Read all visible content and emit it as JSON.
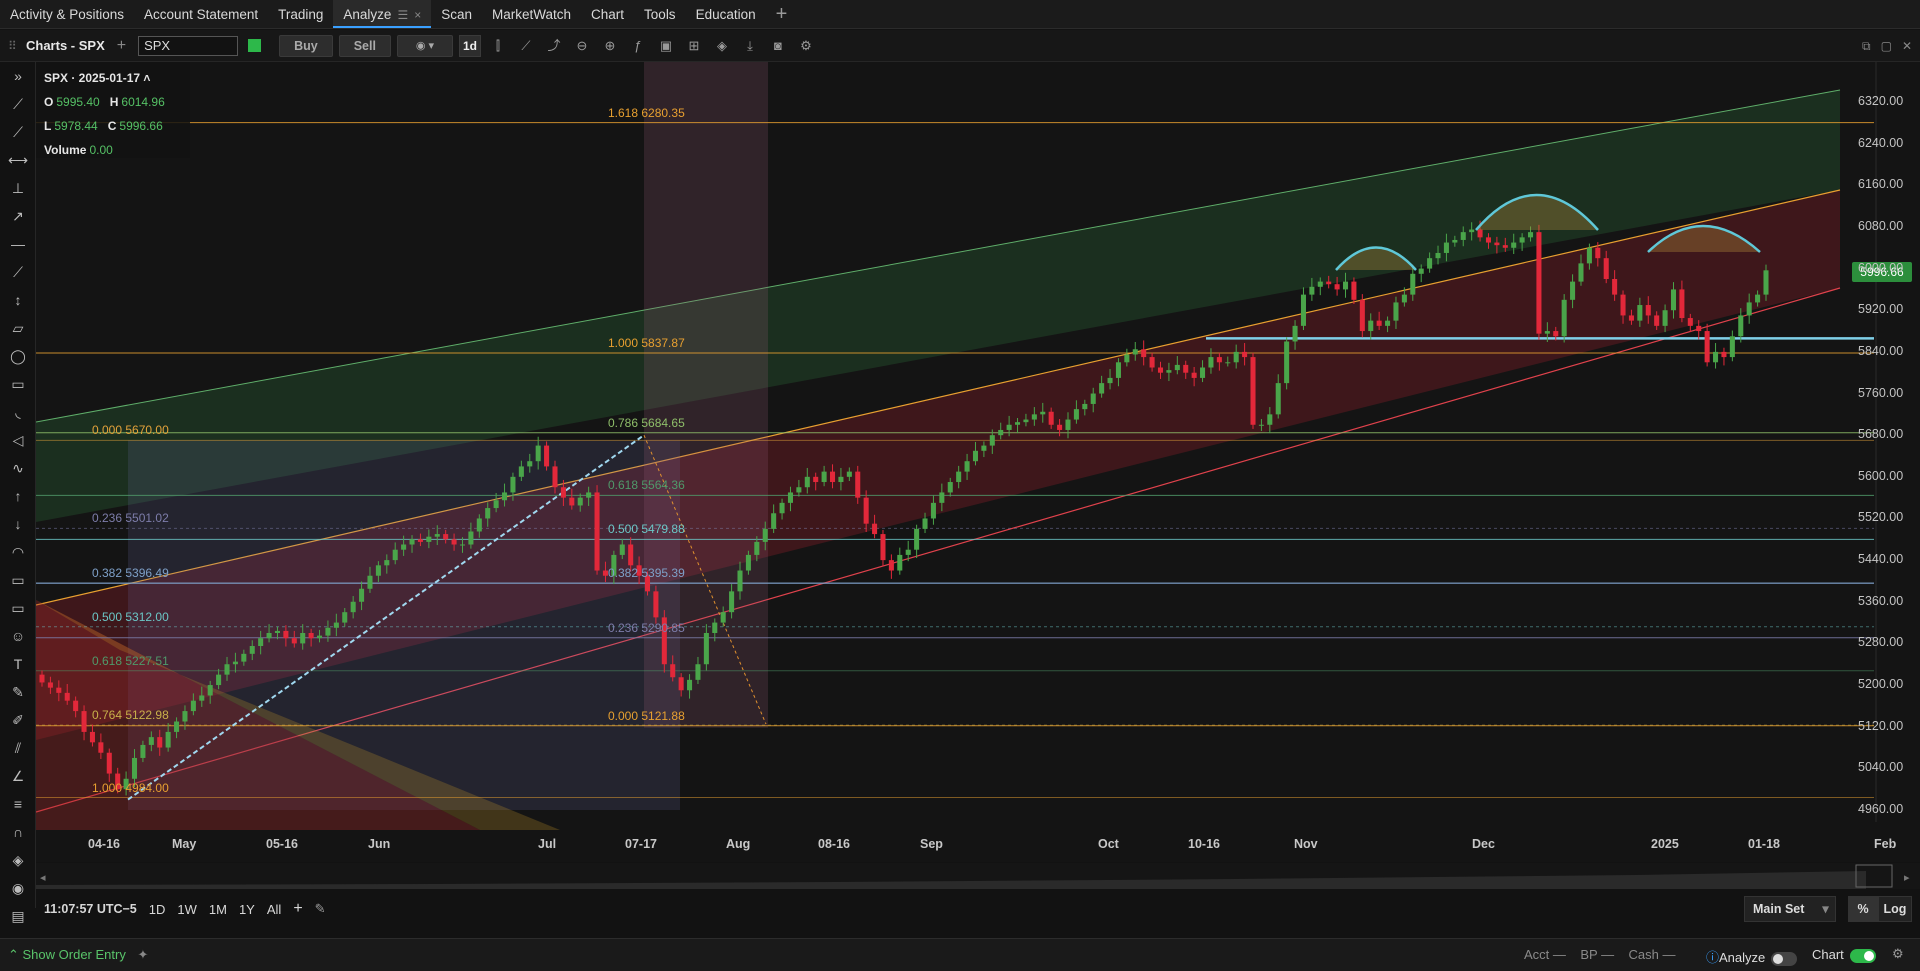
{
  "menu": {
    "tabs": [
      "Activity & Positions",
      "Account Statement",
      "Trading",
      "Analyze",
      "Scan",
      "MarketWatch",
      "Chart",
      "Tools",
      "Education"
    ],
    "active": "Analyze",
    "active_icon": "☰",
    "close_icon": "×",
    "add": "+"
  },
  "chartbar": {
    "title": "Charts - SPX",
    "symbol": "SPX",
    "buy": "Buy",
    "sell": "Sell",
    "timeframe": "1d"
  },
  "ohlc": {
    "header": "SPX · 2025-01-17 ˄",
    "o": "5995.40",
    "h": "6014.96",
    "l": "5978.44",
    "c": "5996.66",
    "volume": "0.00"
  },
  "last_price": "5996.66",
  "chart_data": {
    "type": "candlestick",
    "symbol": "SPX",
    "y_ticks": [
      "6320.00",
      "6240.00",
      "6160.00",
      "6080.00",
      "6000.00",
      "5920.00",
      "5840.00",
      "5760.00",
      "5680.00",
      "5600.00",
      "5520.00",
      "5440.00",
      "5360.00",
      "5280.00",
      "5200.00",
      "5120.00",
      "5040.00",
      "4960.00"
    ],
    "ylim": [
      4930,
      6370
    ],
    "x_ticks": [
      "04-16",
      "May",
      "05-16",
      "Jun",
      "Jul",
      "07-17",
      "Aug",
      "08-16",
      "Sep",
      "Oct",
      "10-16",
      "Nov",
      "Dec",
      "2025",
      "01-18",
      "Feb"
    ],
    "fib_left": [
      {
        "ratio": "0.000",
        "price": "5670.00",
        "color": "#e3a23a"
      },
      {
        "ratio": "0.236",
        "price": "5501.02",
        "color": "#7d7daa"
      },
      {
        "ratio": "0.382",
        "price": "5396.49",
        "color": "#7ea0c8"
      },
      {
        "ratio": "0.500",
        "price": "5312.00",
        "color": "#6bc6c6"
      },
      {
        "ratio": "0.618",
        "price": "5227.51",
        "color": "#4f9a6a"
      },
      {
        "ratio": "0.764",
        "price": "5122.98",
        "color": "#c8b04a"
      },
      {
        "ratio": "1.000",
        "price": "4984.00",
        "color": "#e8a030"
      }
    ],
    "fib_right": [
      {
        "ratio": "1.618",
        "price": "6280.35",
        "color": "#e8a030"
      },
      {
        "ratio": "1.000",
        "price": "5837.87",
        "color": "#e8a030"
      },
      {
        "ratio": "0.786",
        "price": "5684.65",
        "color": "#8fbf6a"
      },
      {
        "ratio": "0.618",
        "price": "5564.36",
        "color": "#4f9a6a"
      },
      {
        "ratio": "0.500",
        "price": "5479.88",
        "color": "#6bc6c6"
      },
      {
        "ratio": "0.382",
        "price": "5395.39",
        "color": "#7ea0c8"
      },
      {
        "ratio": "0.236",
        "price": "5290.85",
        "color": "#7d7daa"
      },
      {
        "ratio": "0.000",
        "price": "5121.88",
        "color": "#e8a030"
      }
    ],
    "closes": [
      5205,
      5195,
      5185,
      5170,
      5150,
      5110,
      5090,
      5070,
      5030,
      5000,
      5020,
      5060,
      5085,
      5100,
      5080,
      5110,
      5130,
      5150,
      5170,
      5180,
      5200,
      5220,
      5240,
      5245,
      5260,
      5275,
      5290,
      5300,
      5304,
      5290,
      5280,
      5300,
      5290,
      5295,
      5310,
      5320,
      5340,
      5360,
      5385,
      5410,
      5430,
      5440,
      5460,
      5470,
      5480,
      5475,
      5485,
      5490,
      5480,
      5470,
      5470,
      5495,
      5520,
      5540,
      5555,
      5570,
      5600,
      5620,
      5630,
      5660,
      5620,
      5580,
      5560,
      5545,
      5560,
      5570,
      5420,
      5410,
      5450,
      5470,
      5430,
      5410,
      5380,
      5330,
      5240,
      5215,
      5190,
      5210,
      5240,
      5300,
      5320,
      5340,
      5380,
      5420,
      5450,
      5475,
      5500,
      5530,
      5550,
      5570,
      5580,
      5600,
      5590,
      5610,
      5590,
      5600,
      5610,
      5560,
      5510,
      5490,
      5440,
      5420,
      5450,
      5460,
      5500,
      5520,
      5550,
      5570,
      5590,
      5610,
      5630,
      5650,
      5660,
      5680,
      5690,
      5700,
      5705,
      5710,
      5720,
      5725,
      5700,
      5690,
      5710,
      5730,
      5740,
      5760,
      5780,
      5790,
      5820,
      5835,
      5845,
      5830,
      5810,
      5800,
      5805,
      5815,
      5800,
      5790,
      5810,
      5830,
      5820,
      5820,
      5840,
      5830,
      5700,
      5700,
      5720,
      5780,
      5860,
      5890,
      5950,
      5965,
      5975,
      5970,
      5960,
      5975,
      5940,
      5880,
      5900,
      5890,
      5900,
      5935,
      5950,
      5990,
      6000,
      6020,
      6030,
      6050,
      6055,
      6070,
      6075,
      6060,
      6050,
      6045,
      6040,
      6050,
      6060,
      6070,
      5875,
      5880,
      5870,
      5940,
      5975,
      6010,
      6040,
      6020,
      5980,
      5950,
      5910,
      5900,
      5930,
      5910,
      5890,
      5920,
      5960,
      5905,
      5890,
      5880,
      5820,
      5840,
      5830,
      5870,
      5910,
      5935,
      5950,
      5996.66
    ]
  },
  "bottom": {
    "time": "11:07:57 UTC−5",
    "ranges": [
      "1D",
      "1W",
      "1M",
      "1Y",
      "All"
    ],
    "main_set": "Main Set",
    "pct": "%",
    "log": "Log"
  },
  "status": {
    "show_order": "Show Order Entry",
    "acct": "Acct —",
    "bp": "BP —",
    "cash": "Cash —",
    "analyze": "Analyze",
    "chart": "Chart"
  }
}
